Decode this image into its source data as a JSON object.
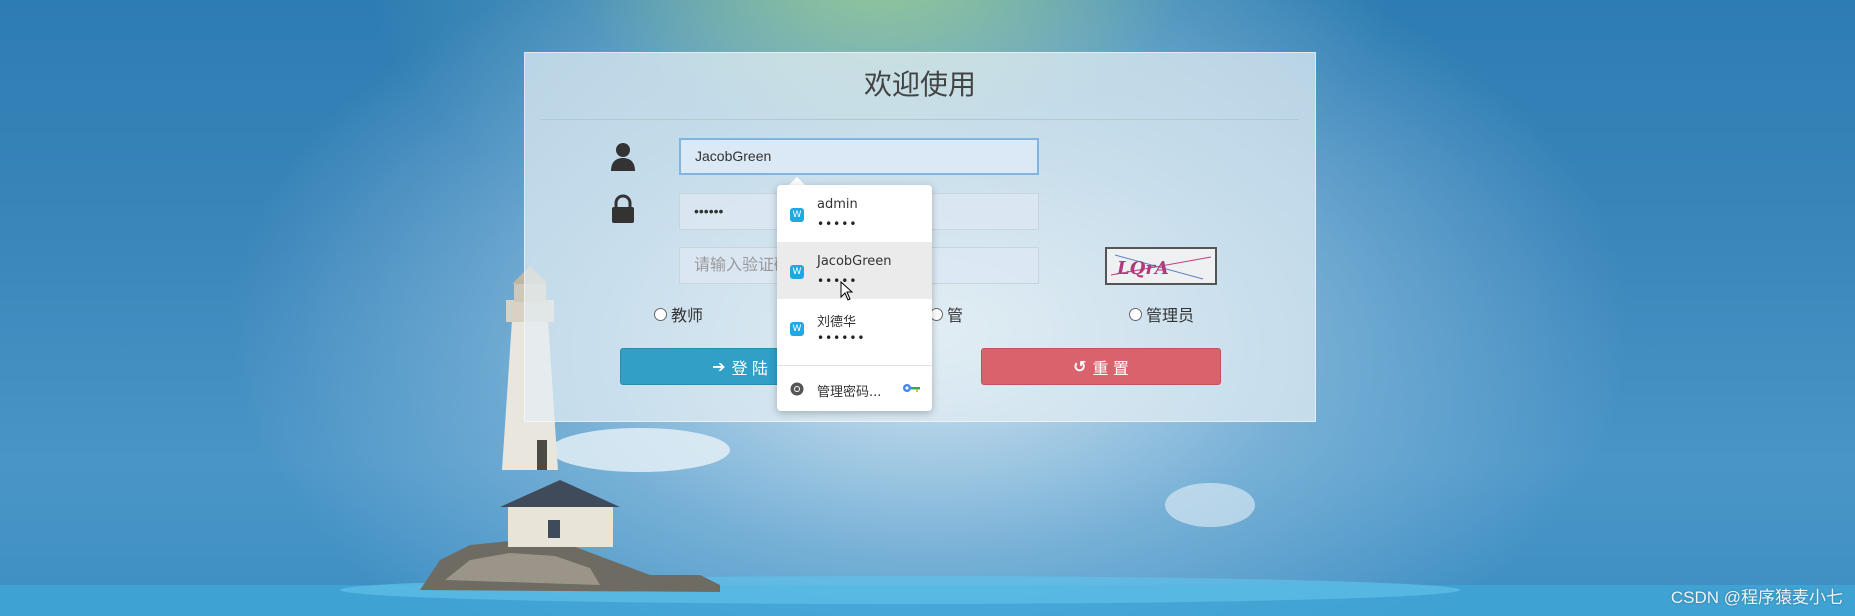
{
  "panel": {
    "title": "欢迎使用"
  },
  "form": {
    "username_value": "JacobGreen",
    "password_mask": "••••••",
    "captcha_placeholder": "请输入验证码",
    "captcha_text": "LQrA"
  },
  "roles": [
    {
      "label": "教师"
    },
    {
      "label": "管"
    },
    {
      "label": "管理员"
    }
  ],
  "buttons": {
    "login_label": "登 陆",
    "reset_label": "重 置"
  },
  "autofill": {
    "items": [
      {
        "user": "admin",
        "mask": "•••••"
      },
      {
        "user": "JacobGreen",
        "mask": "•••••"
      },
      {
        "user": "刘德华",
        "mask": "••••••"
      }
    ],
    "manage_label": "管理密码..."
  },
  "watermark": "CSDN @程序猿麦小七",
  "colors": {
    "login": "#31a0c6",
    "reset": "#d9636c",
    "autofill_site": "#21a8e3"
  },
  "icons": [
    "user-icon",
    "lock-icon",
    "arrow-right-icon",
    "undo-icon",
    "chrome-icon",
    "key-icon",
    "site-icon"
  ]
}
